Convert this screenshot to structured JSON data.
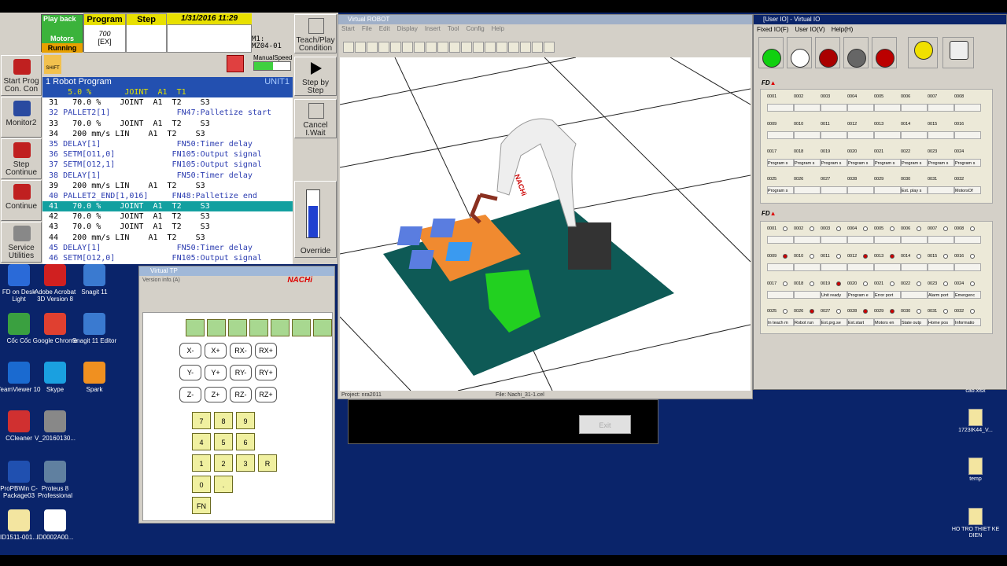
{
  "header": {
    "status_playback": "Play back",
    "status_motors": "Motors",
    "status_running": "Running",
    "program_label": "Program",
    "program_value": "700",
    "program_sub": "[EX]",
    "step_label": "Step",
    "datetime": "1/31/2016 11:29",
    "mz_code": "M1:\nMZ04-01",
    "manual_speed_label": "ManualSpeed",
    "shift_label": "SHIFT"
  },
  "left_menu": [
    {
      "label": "Start Prog Con. Con"
    },
    {
      "label": "Monitor2"
    },
    {
      "label": "Step Continue"
    },
    {
      "label": "Continue"
    },
    {
      "label": "Service Utilities"
    }
  ],
  "right_menu": [
    {
      "label": "Teach/Play Condition"
    },
    {
      "label": "Step by Step"
    },
    {
      "label": "Cancel I.Wait"
    },
    {
      "label": "Override"
    }
  ],
  "program": {
    "title": "1 Robot Program",
    "unit": "UNIT1",
    "rows": [
      "     5.0 %       JOINT  A1  T1",
      " 31   70.0 %    JOINT  A1  T2    S3",
      " 32 PALLET2[1]              FN47:Palletize start",
      " 33   70.0 %    JOINT  A1  T2    S3",
      " 34   200 mm/s LIN    A1  T2    S3",
      " 35 DELAY[1]                FN50:Timer delay",
      " 36 SETM[O11,0]            FN105:Output signal",
      " 37 SETM[O12,1]            FN105:Output signal",
      " 38 DELAY[1]                FN50:Timer delay",
      " 39   200 mm/s LIN    A1  T2    S3",
      " 40 PALLET2_END[1,016]     FN48:Palletize end",
      " 41   70.0 %    JOINT  A1  T2    S3",
      " 42   70.0 %    JOINT  A1  T2    S3",
      " 43   70.0 %    JOINT  A1  T2    S3",
      " 44   200 mm/s LIN    A1  T2    S3",
      " 45 DELAY[1]                FN50:Timer delay",
      " 46 SETM[O12,0]            FN105:Output signal"
    ]
  },
  "desktop_left": [
    {
      "label": "FD on Desk Light",
      "color": "#2a6ad8"
    },
    {
      "label": "Adobe Acrobat 3D Version 8",
      "color": "#d02020"
    },
    {
      "label": "Snagit 11",
      "color": "#3a7ad0"
    },
    {
      "label": "Cốc Cốc",
      "color": "#3aa040"
    },
    {
      "label": "Google Chrome",
      "color": "#e04030"
    },
    {
      "label": "Snagit 11 Editor",
      "color": "#3a7ad0"
    },
    {
      "label": "TeamViewer 10",
      "color": "#1a6ad0"
    },
    {
      "label": "Skype",
      "color": "#1aa0e0"
    },
    {
      "label": "Spark",
      "color": "#f09020"
    },
    {
      "label": "CCleaner",
      "color": "#d03030"
    },
    {
      "label": "V_20160130...",
      "color": "#888888"
    },
    {
      "label": "ProPBWin C-Package03",
      "color": "#2050b0"
    },
    {
      "label": "Proteus 8 Professional",
      "color": "#6080a0"
    },
    {
      "label": "ID1511-001...",
      "color": "#f3e5a0"
    },
    {
      "label": "ID0002A00...",
      "color": "#ffffff"
    }
  ],
  "virtual_tp": {
    "title": "Virtual TP",
    "version": "Version info.(A)",
    "logo": "NACHi",
    "jog_buttons": [
      "X-",
      "X+",
      "RX-",
      "RX+",
      "Y-",
      "Y+",
      "RY-",
      "RY+",
      "Z-",
      "Z+",
      "RZ-",
      "RZ+"
    ],
    "keypad": [
      "7",
      "8",
      "9",
      "4",
      "5",
      "6",
      "1",
      "2",
      "3",
      "0",
      ".",
      "FN",
      "R"
    ]
  },
  "virtual_robot": {
    "title": "Virtual ROBOT",
    "menu": [
      "Start",
      "File",
      "Edit",
      "Display",
      "Insert",
      "Tool",
      "Config",
      "Help"
    ],
    "project": "Project: nra2011",
    "file": "File: Nachi_31-1.cel",
    "robot_brand": "NACHi"
  },
  "exit_label": "Exit",
  "virtual_io": {
    "title": "[User IO] - Virtual IO",
    "menu": [
      "Fixed IO(F)",
      "User IO(V)",
      "Help(H)"
    ],
    "fd1": "FD",
    "fd2": "FD",
    "in_nums_row1": [
      "0001",
      "0002",
      "0003",
      "0004",
      "0005",
      "0006",
      "0007",
      "0008"
    ],
    "in_nums_row2": [
      "0009",
      "0010",
      "0011",
      "0012",
      "0013",
      "0014",
      "0015",
      "0016"
    ],
    "in_nums_row3": [
      "0017",
      "0018",
      "0019",
      "0020",
      "0021",
      "0022",
      "0023",
      "0024"
    ],
    "in_nums_row4": [
      "0025",
      "0026",
      "0027",
      "0028",
      "0029",
      "0030",
      "0031",
      "0032"
    ],
    "in_labels_row3": [
      "Program s",
      "Program s",
      "Program s",
      "Program s",
      "Program s",
      "Program s",
      "Program s",
      "Program s"
    ],
    "in_labels_row4": [
      "Program s",
      "",
      "",
      "",
      "",
      "Ext. play s",
      "",
      "MotorsOf"
    ],
    "out_labels_row3": [
      "",
      "",
      "Unit ready",
      "Program e",
      "Error port",
      "",
      "Alarm port",
      "Emergenc"
    ],
    "out_labels_row4": [
      "In teach m",
      "Robot run",
      "Ext.prg.se",
      "Ext.start",
      "Motors en",
      "State outp",
      "Home pos",
      "Informatio"
    ]
  },
  "desktop_right": [
    {
      "label": "cao.xlsx"
    },
    {
      "label": "1723IK44_V..."
    },
    {
      "label": "temp"
    },
    {
      "label": "HO TRO THIET KE DIEN"
    }
  ]
}
